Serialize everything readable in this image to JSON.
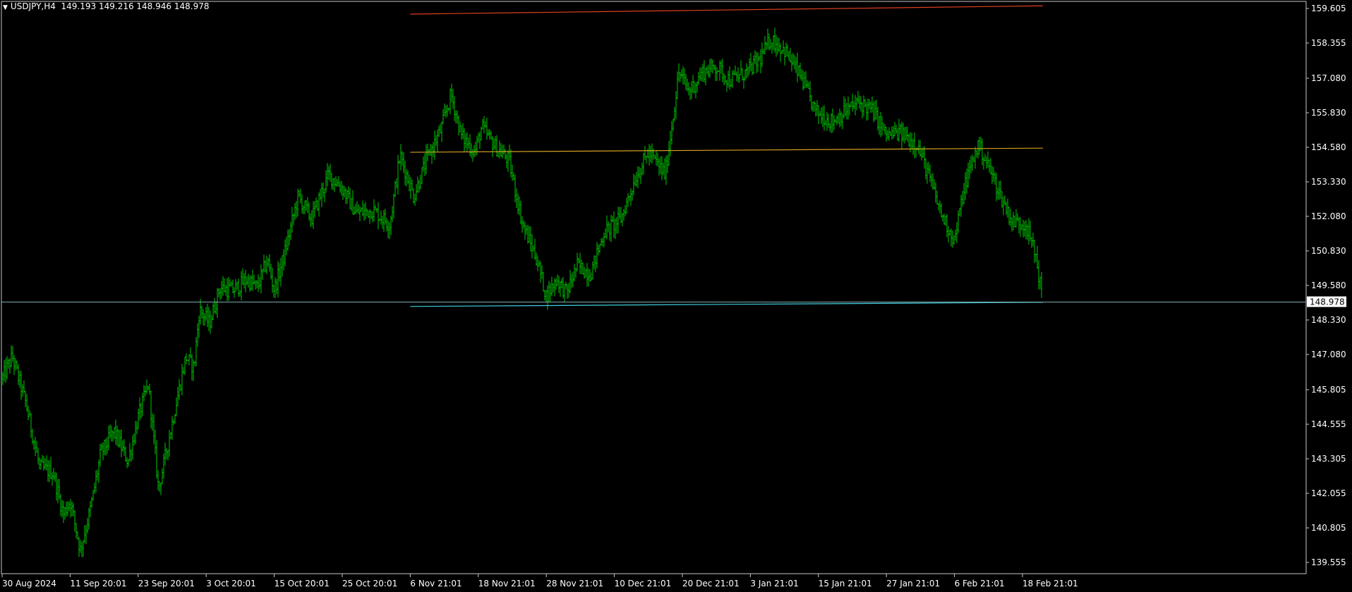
{
  "header": {
    "symbol": "USDJPY,H4",
    "ohlc": "149.193 149.216 148.946 148.978",
    "menu_icon": "triangle-down-icon"
  },
  "colors": {
    "background": "#000000",
    "candle": "#00c800",
    "frame": "#c8c8c8",
    "bid_line": "#7fb0b0",
    "resistance": "#e04020",
    "mid_line": "#d4a020",
    "support": "#40d0e0",
    "price_label_bg": "#ffffff",
    "price_label_text": "#000000",
    "text": "#ffffff"
  },
  "price_axis": {
    "labels": [
      "159.605",
      "158.355",
      "157.080",
      "155.830",
      "154.580",
      "153.330",
      "152.080",
      "150.830",
      "149.580",
      "148.330",
      "147.080",
      "145.805",
      "144.555",
      "143.305",
      "142.055",
      "140.805",
      "139.555"
    ],
    "current_price": "148.978"
  },
  "time_axis": {
    "labels": [
      "30 Aug 2024",
      "11 Sep 20:01",
      "23 Sep 20:01",
      "3 Oct 20:01",
      "15 Oct 20:01",
      "25 Oct 20:01",
      "6 Nov 21:01",
      "18 Nov 21:01",
      "28 Nov 21:01",
      "10 Dec 21:01",
      "20 Dec 21:01",
      "3 Jan 21:01",
      "15 Jan 21:01",
      "27 Jan 21:01",
      "6 Feb 21:01",
      "18 Feb 21:01"
    ]
  },
  "chart_data": {
    "type": "line",
    "title": "USDJPY,H4",
    "xlabel": "",
    "ylabel": "",
    "ylim": [
      139.3,
      159.8
    ],
    "grid": false,
    "x": [
      "30 Aug 2024",
      "11 Sep 20:01",
      "23 Sep 20:01",
      "3 Oct 20:01",
      "15 Oct 20:01",
      "25 Oct 20:01",
      "6 Nov 21:01",
      "18 Nov 21:01",
      "28 Nov 21:01",
      "10 Dec 21:01",
      "20 Dec 21:01",
      "3 Jan 21:01",
      "15 Jan 21:01",
      "27 Jan 21:01",
      "6 Feb 21:01",
      "18 Feb 21:01"
    ],
    "series": [
      {
        "name": "USDJPY,H4",
        "points": [
          [
            0,
            146.2
          ],
          [
            0.15,
            147.0
          ],
          [
            0.35,
            145.3
          ],
          [
            0.55,
            143.0
          ],
          [
            0.75,
            142.8
          ],
          [
            0.9,
            141.3
          ],
          [
            1.0,
            141.8
          ],
          [
            1.15,
            140.0
          ],
          [
            1.3,
            141.5
          ],
          [
            1.45,
            143.5
          ],
          [
            1.65,
            144.3
          ],
          [
            1.85,
            143.2
          ],
          [
            2.0,
            144.8
          ],
          [
            2.15,
            146.0
          ],
          [
            2.3,
            142.2
          ],
          [
            2.45,
            144.0
          ],
          [
            2.7,
            147.0
          ],
          [
            2.82,
            146.6
          ],
          [
            2.9,
            148.7
          ],
          [
            3.05,
            148.2
          ],
          [
            3.2,
            149.5
          ],
          [
            3.4,
            149.4
          ],
          [
            3.6,
            149.8
          ],
          [
            3.75,
            149.5
          ],
          [
            3.9,
            150.5
          ],
          [
            4.0,
            149.4
          ],
          [
            4.15,
            150.7
          ],
          [
            4.35,
            152.8
          ],
          [
            4.55,
            152.0
          ],
          [
            4.8,
            153.6
          ],
          [
            5.0,
            153.1
          ],
          [
            5.2,
            152.2
          ],
          [
            5.45,
            152.3
          ],
          [
            5.7,
            151.8
          ],
          [
            5.85,
            154.3
          ],
          [
            6.05,
            152.8
          ],
          [
            6.25,
            154.2
          ],
          [
            6.45,
            155.2
          ],
          [
            6.6,
            156.5
          ],
          [
            6.75,
            155.0
          ],
          [
            6.95,
            154.4
          ],
          [
            7.05,
            155.3
          ],
          [
            7.25,
            154.6
          ],
          [
            7.45,
            154.1
          ],
          [
            7.65,
            151.8
          ],
          [
            7.85,
            150.6
          ],
          [
            8.0,
            149.2
          ],
          [
            8.15,
            149.8
          ],
          [
            8.3,
            149.3
          ],
          [
            8.45,
            150.3
          ],
          [
            8.65,
            150.0
          ],
          [
            8.85,
            151.5
          ],
          [
            9.1,
            152.0
          ],
          [
            9.3,
            153.4
          ],
          [
            9.5,
            154.4
          ],
          [
            9.75,
            153.6
          ],
          [
            9.95,
            157.3
          ],
          [
            10.1,
            156.6
          ],
          [
            10.3,
            157.3
          ],
          [
            10.5,
            157.5
          ],
          [
            10.7,
            157.0
          ],
          [
            10.95,
            157.3
          ],
          [
            11.15,
            157.8
          ],
          [
            11.3,
            158.5
          ],
          [
            11.5,
            158.1
          ],
          [
            11.75,
            157.1
          ],
          [
            11.95,
            155.9
          ],
          [
            12.2,
            155.5
          ],
          [
            12.4,
            155.9
          ],
          [
            12.6,
            156.2
          ],
          [
            12.8,
            155.9
          ],
          [
            13.0,
            155.0
          ],
          [
            13.2,
            155.1
          ],
          [
            13.45,
            154.7
          ],
          [
            13.6,
            153.7
          ],
          [
            13.8,
            152.2
          ],
          [
            14.0,
            151.2
          ],
          [
            14.15,
            153.2
          ],
          [
            14.35,
            154.7
          ],
          [
            14.5,
            153.9
          ],
          [
            14.7,
            152.7
          ],
          [
            14.85,
            151.9
          ],
          [
            15.05,
            151.8
          ],
          [
            15.2,
            150.6
          ],
          [
            15.3,
            148.98
          ]
        ]
      }
    ],
    "lines": [
      {
        "name": "",
        "x": [
          6.0,
          15.3
        ],
        "y": [
          159.4,
          159.7
        ]
      },
      {
        "name": "",
        "x": [
          6.0,
          15.3
        ],
        "y": [
          154.4,
          154.55
        ]
      },
      {
        "name": "",
        "x": [
          6.0,
          15.3
        ],
        "y": [
          148.82,
          148.97
        ]
      }
    ],
    "current_price": 148.978
  }
}
